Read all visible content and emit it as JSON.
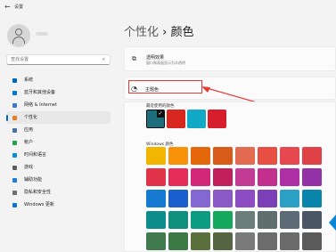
{
  "window": {
    "back_icon": "arrow-left-icon",
    "title": "设置"
  },
  "search": {
    "placeholder": "查找设置",
    "icon": "search-icon"
  },
  "sidebar": {
    "items": [
      {
        "label": "系统",
        "color": "#0067c0",
        "active": false
      },
      {
        "label": "蓝牙和其他设备",
        "color": "#0078d4",
        "active": false
      },
      {
        "label": "网络 & Internet",
        "color": "#3a78c9",
        "active": false
      },
      {
        "label": "个性化",
        "color": "#e97a20",
        "active": true
      },
      {
        "label": "应用",
        "color": "#4a6fa5",
        "active": false
      },
      {
        "label": "帐户",
        "color": "#1fa34a",
        "active": false
      },
      {
        "label": "时间和语言",
        "color": "#0b8bd9",
        "active": false
      },
      {
        "label": "游戏",
        "color": "#5b5b5b",
        "active": false
      },
      {
        "label": "辅助功能",
        "color": "#1c7ed6",
        "active": false
      },
      {
        "label": "隐私和安全性",
        "color": "#6e6e6e",
        "active": false
      },
      {
        "label": "Windows 更新",
        "color": "#0a74d2",
        "active": false
      }
    ]
  },
  "header": {
    "breadcrumb_parent": "个性化",
    "separator": "›",
    "title": "颜色"
  },
  "transparency": {
    "title": "透明效果",
    "desc": "窗口和表面显示为半透明"
  },
  "accent": {
    "label": "主题色"
  },
  "recent_colors": {
    "label": "最近使用的颜色",
    "colors": [
      "#1f6e7e",
      "#d8271f",
      "#12a9c6",
      "#d61e2c"
    ],
    "selected_index": 0
  },
  "windows_colors": {
    "label": "Windows 颜色",
    "rows": [
      [
        "#f2b600",
        "#f7920a",
        "#e4680b",
        "#d95b19",
        "#e26b51",
        "#e74f43",
        "#e6484f",
        "#e04347"
      ],
      [
        "#e1334a",
        "#e62c5a",
        "#d1287a",
        "#c21f5b",
        "#c23c95",
        "#c32f8f",
        "#ae2ea4",
        "#9331a6"
      ],
      [
        "#157ad0",
        "#1a5fcd",
        "#8368d1",
        "#8a59c6",
        "#8c4cc2",
        "#7b3fb7",
        "#2ba0c4",
        "#0a86ad"
      ],
      [
        "#0d8c8c",
        "#0f8f7d",
        "#0b9c82",
        "#13a85c",
        "#6c7e7a",
        "#5e6f6d",
        "#5c6b75",
        "#4a5663"
      ],
      [
        "#417a4d",
        "#3b7a45",
        "#5b6f3c",
        "#566542",
        "#7a7a7a",
        "#6c6c6c",
        "#6b6b6b",
        "#5a5a5a"
      ]
    ]
  }
}
